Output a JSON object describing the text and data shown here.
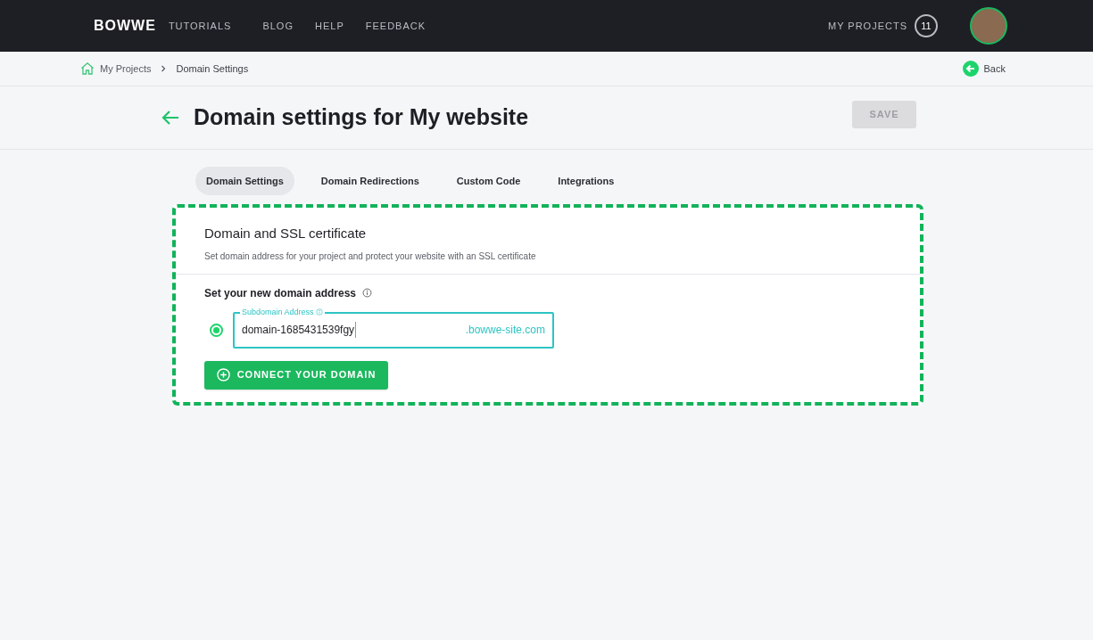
{
  "header": {
    "logo": "BOWWE",
    "nav": [
      {
        "label": "TUTORIALS"
      },
      {
        "label": "BLOG"
      },
      {
        "label": "HELP"
      },
      {
        "label": "FEEDBACK"
      }
    ],
    "projects_label": "MY PROJECTS",
    "projects_count": "11"
  },
  "breadcrumb": {
    "items": [
      "My Projects",
      "Domain Settings"
    ],
    "back": "Back"
  },
  "page": {
    "title": "Domain settings for My website",
    "save": {
      "label": "SAVE",
      "disabled": true
    }
  },
  "tabs": [
    {
      "label": "Domain Settings",
      "selected": true
    },
    {
      "label": "Domain Redirections",
      "selected": false
    },
    {
      "label": "Custom Code",
      "selected": false
    },
    {
      "label": "Integrations",
      "selected": false
    }
  ],
  "card": {
    "highlighted": true,
    "title": "Domain and SSL certificate",
    "subtitle": "Set domain address for your project and protect your website with an SSL certificate",
    "section_label": "Set your new domain address",
    "option": {
      "selected": true,
      "field_label": "Subdomain Address",
      "value": "domain-1685431539fgy",
      "suffix": ".bowwe-site.com"
    },
    "connect_button": "CONNECT YOUR DOMAIN"
  }
}
